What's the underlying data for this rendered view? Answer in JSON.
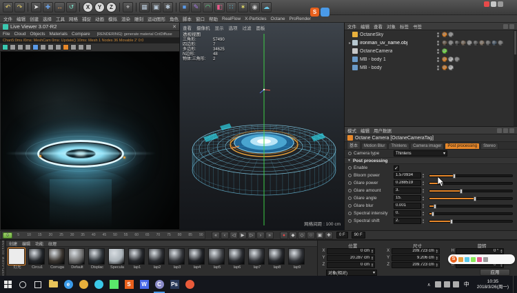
{
  "topbar": {
    "icons": [
      {
        "name": "undo-icon",
        "glyph": "↶",
        "color": "#e8d06a"
      },
      {
        "name": "redo-icon",
        "glyph": "↷",
        "color": "#e8d06a"
      },
      {
        "sep": true
      },
      {
        "name": "live-select-icon",
        "glyph": "➤",
        "color": "#ececec"
      },
      {
        "name": "move-icon",
        "glyph": "✚",
        "color": "#6aa2e8"
      },
      {
        "name": "scale-icon",
        "glyph": "↔",
        "color": "#e8a05a"
      },
      {
        "name": "rotate-icon",
        "glyph": "↺",
        "color": "#7ae0c8"
      },
      {
        "sep": true
      },
      {
        "name": "x-axis-button",
        "glyph": "X",
        "color": "#222",
        "round": true
      },
      {
        "name": "y-axis-button",
        "glyph": "Y",
        "color": "#222",
        "round": true
      },
      {
        "name": "z-axis-button",
        "glyph": "Z",
        "color": "#222",
        "round": true
      },
      {
        "sep": true
      },
      {
        "name": "coord-system-icon",
        "glyph": "⌖",
        "color": "#c8c8c8"
      },
      {
        "sep": true
      },
      {
        "name": "render-view-icon",
        "glyph": "▦",
        "color": "#b8c8d8"
      },
      {
        "name": "render-picture-icon",
        "glyph": "▣",
        "color": "#b8c8d8"
      },
      {
        "name": "render-settings-icon",
        "glyph": "✱",
        "color": "#b8c8d8"
      },
      {
        "sep": true
      },
      {
        "name": "add-cube-icon",
        "glyph": "■",
        "color": "#5a9ae8"
      },
      {
        "name": "add-spline-icon",
        "glyph": "✎",
        "color": "#a87ae8"
      },
      {
        "name": "add-generator-icon",
        "glyph": "◠",
        "color": "#5ae88a"
      },
      {
        "name": "add-deformer-icon",
        "glyph": "◧",
        "color": "#e85a8a"
      },
      {
        "name": "add-field-icon",
        "glyph": "∷",
        "color": "#5ac8e8"
      },
      {
        "name": "add-light-icon",
        "glyph": "✶",
        "color": "#e8e06a"
      },
      {
        "name": "add-camera-icon",
        "glyph": "◉",
        "color": "#c8c8c8"
      },
      {
        "name": "add-sky-icon",
        "glyph": "☁",
        "color": "#6ac8e8"
      }
    ]
  },
  "menubar": {
    "items": [
      "文件",
      "编辑",
      "创建",
      "选择",
      "工具",
      "网格",
      "捕捉",
      "动画",
      "模拟",
      "渲染",
      "雕刻",
      "运动图形",
      "角色",
      "脚本",
      "窗口",
      "帮助"
    ],
    "plugins": [
      "RealFlow",
      "X-Particles",
      "Octane",
      "ProRender"
    ]
  },
  "live_viewer": {
    "title": "Live Viewer 3.07-R2",
    "close": "✕",
    "menus": [
      "File",
      "Cloud",
      "Objects",
      "Materials",
      "Compare"
    ],
    "status": "[RENDERING]: generate material CntDiffuse",
    "stats": "Chan5:0ms /0ms: MeshCam 0ms: Update() 10ms: Mesh 1 Nodes 36 Movable 2' 0:0",
    "toolbar": [
      {
        "name": "power-icon",
        "color": "#3ac8b0"
      },
      {
        "name": "restart-icon",
        "color": "#9a9a9a"
      },
      {
        "name": "pause-icon",
        "color": "#9a9a9a"
      },
      {
        "name": "lock-resolution-icon",
        "color": "#9a9a9a"
      },
      {
        "name": "camera-sync-icon",
        "color": "#5a9ae8"
      },
      {
        "name": "picture-icon",
        "color": "#9a9a9a"
      },
      {
        "name": "render-region-icon",
        "color": "#9a9a9a"
      },
      {
        "name": "focus-pick-icon",
        "color": "#9a9a9a"
      },
      {
        "name": "material-pick-icon",
        "color": "#e8882a"
      },
      {
        "name": "settings-icon",
        "color": "#9a9a9a"
      },
      {
        "name": "clay-mode-icon",
        "color": "#9a9a9a"
      },
      {
        "name": "filter-icon",
        "color": "#9a9a9a"
      }
    ]
  },
  "viewport": {
    "menus": [
      "查看",
      "摄像机",
      "显示",
      "选项",
      "过滤",
      "面板"
    ],
    "hud_title": "透视视图",
    "hud": [
      {
        "label": "三角形",
        "value": "57490"
      },
      {
        "label": "四边形",
        "value": "7"
      },
      {
        "label": "多边形",
        "value": "34625"
      },
      {
        "label": "N边形",
        "value": "48"
      },
      {
        "label": "物体:三角形",
        "value": "2"
      }
    ],
    "grid_label": "网格间距 : 100 cm"
  },
  "object_manager": {
    "menus": [
      "文件",
      "编辑",
      "查看",
      "对象",
      "标签",
      "书签"
    ],
    "items": [
      {
        "name": "OctaneSky",
        "icon": "sky-object-icon",
        "icon_color": "#e8b03c",
        "expand": false,
        "bold": false,
        "tags": [
          "#e8882a",
          "#9a9a9a"
        ]
      },
      {
        "name": "ironman_uv_name.obj",
        "icon": "mesh-object-icon",
        "icon_color": "#b8c8d0",
        "expand": true,
        "bold": true,
        "tags": [
          "#6a5a4a",
          "#8a8a8a",
          "#4a4a4a",
          "#7a6a5a",
          "#9a9a9a",
          "#5a5a5a",
          "#8a7a6a",
          "#6a6a6a",
          "#4a5a6a",
          "#7a7a7a"
        ]
      },
      {
        "name": "OctaneCamera",
        "icon": "camera-object-icon",
        "icon_color": "#c8c8c8",
        "expand": false,
        "bold": false,
        "tags": [
          "#7ae84a"
        ]
      },
      {
        "name": "MB - body 1",
        "icon": "polygon-object-icon",
        "icon_color": "#6a9ac8",
        "expand": false,
        "bold": false,
        "tags": [
          "#e8882a",
          "#c8c8c8",
          "#8a8a8a"
        ]
      },
      {
        "name": "MB - body",
        "icon": "polygon-object-icon",
        "icon_color": "#6a9ac8",
        "expand": false,
        "bold": false,
        "tags": [
          "#e8882a",
          "#c8c8c8"
        ]
      }
    ]
  },
  "attributes": {
    "header_menus": [
      "模式",
      "编辑",
      "用户数据"
    ],
    "title": "Octane Camera [OctaneCameraTag]",
    "tabs": [
      {
        "label": "基本",
        "active": false
      },
      {
        "label": "Motion Blur",
        "active": false
      },
      {
        "label": "Thinlens",
        "active": false
      },
      {
        "label": "Camera imager",
        "active": false
      },
      {
        "label": "Post processing",
        "active": true
      },
      {
        "label": "Stereo",
        "active": false
      }
    ],
    "camera_type_label": "Camera type",
    "camera_type_value": "Thinlens",
    "section": "Post processing",
    "params": [
      {
        "label": "Enable",
        "type": "check",
        "checked": true
      },
      {
        "label": "Bloom power",
        "value": "1.570934",
        "frac": 0.3
      },
      {
        "label": "Glare power",
        "value": "0.288519",
        "frac": 0.15
      },
      {
        "label": "Glare amount",
        "value": "3.",
        "frac": 0.38
      },
      {
        "label": "Glare angle",
        "value": "15.",
        "frac": 0.55
      },
      {
        "label": "Glare blur",
        "value": "0.001",
        "frac": 0.07
      },
      {
        "label": "Spectral intensity",
        "value": "0.",
        "frac": 0.04
      },
      {
        "label": "Spectral shift",
        "value": "2.",
        "frac": 0.27
      }
    ]
  },
  "timeline": {
    "current": "0",
    "ticks": [
      "0",
      "5",
      "10",
      "15",
      "20",
      "25",
      "30",
      "35",
      "40",
      "45",
      "50",
      "55",
      "60",
      "65",
      "70",
      "75",
      "80",
      "85",
      "90"
    ],
    "transport": [
      {
        "name": "goto-start-button",
        "glyph": "«",
        "color": "#cacaca"
      },
      {
        "name": "prev-key-button",
        "glyph": "‹",
        "color": "#cacaca"
      },
      {
        "name": "prev-frame-button",
        "glyph": "◁",
        "color": "#cacaca"
      },
      {
        "name": "play-button",
        "glyph": "▶",
        "color": "#cacaca"
      },
      {
        "name": "next-frame-button",
        "glyph": "▷",
        "color": "#cacaca"
      },
      {
        "name": "next-key-button",
        "glyph": "›",
        "color": "#cacaca"
      },
      {
        "name": "goto-end-button",
        "glyph": "»",
        "color": "#cacaca"
      }
    ],
    "record": [
      {
        "name": "record-button",
        "glyph": "●",
        "color": "#e84a4a"
      },
      {
        "name": "autokey-button",
        "glyph": "◆",
        "color": "#cacaca"
      },
      {
        "name": "key-position-button",
        "glyph": "◇",
        "color": "#cacaca"
      },
      {
        "name": "key-scale-button",
        "glyph": "○",
        "color": "#cacaca"
      },
      {
        "name": "key-rotation-button",
        "glyph": "▣",
        "color": "#cacaca"
      },
      {
        "name": "key-parameter-button",
        "glyph": "✚",
        "color": "#cacaca"
      }
    ],
    "start_field": "0 F",
    "end_field": "90 F"
  },
  "materials": {
    "menus": [
      "创建",
      "编辑",
      "功能",
      "纹理"
    ],
    "side_tabs": [
      "OCTANE",
      "DISPLACEM"
    ],
    "items": [
      {
        "label": "灯光",
        "color": "#ececec",
        "flat": true,
        "selected": true
      },
      {
        "label": "Circu1",
        "color": "#23262a"
      },
      {
        "label": "Corruga",
        "color": "#3a3530"
      },
      {
        "label": "Default",
        "color": "#6e6e6e"
      },
      {
        "label": "Displac",
        "color": "#2e3338"
      },
      {
        "label": "Specula",
        "color": "#aab2b8"
      },
      {
        "label": "lap1",
        "color": "#26282c"
      },
      {
        "label": "lap2",
        "color": "#2c2e32"
      },
      {
        "label": "lap3",
        "color": "#34363a"
      },
      {
        "label": "lap4",
        "color": "#222428"
      },
      {
        "label": "lap5",
        "color": "#3c3e42"
      },
      {
        "label": "lap6",
        "color": "#2a2c30"
      },
      {
        "label": "lap7",
        "color": "#303236"
      },
      {
        "label": "lap8",
        "color": "#26282c"
      },
      {
        "label": "lap9",
        "color": "#2e3034"
      }
    ]
  },
  "coords": {
    "groups": [
      {
        "title": "位置",
        "rows": [
          {
            "axis": "X",
            "value": "0 cm"
          },
          {
            "axis": "Y",
            "value": "20.287 cm"
          },
          {
            "axis": "Z",
            "value": "0 cm"
          }
        ]
      },
      {
        "title": "尺寸",
        "rows": [
          {
            "axis": "X",
            "value": "209.723 cm"
          },
          {
            "axis": "Y",
            "value": "9.206 cm"
          },
          {
            "axis": "Z",
            "value": "209.723 cm"
          }
        ]
      },
      {
        "title": "旋转",
        "rows": [
          {
            "axis": "H",
            "value": "0 °"
          },
          {
            "axis": "P",
            "value": "0 °"
          },
          {
            "axis": "B",
            "value": "0 °"
          }
        ]
      }
    ],
    "mode": "对象(相对)",
    "apply_label": "应用"
  },
  "taskbar": {
    "icons": [
      {
        "name": "search-icon",
        "shape": "circ"
      },
      {
        "name": "task-view-icon",
        "shape": "sq"
      },
      {
        "name": "file-explorer-icon",
        "shape": "folder"
      },
      {
        "name": "edge-icon",
        "shape": "circle",
        "color": "#3a9ae8",
        "glyph": "e"
      },
      {
        "name": "chrome-icon",
        "shape": "circle",
        "color": "#e8b03c",
        "glyph": ""
      },
      {
        "name": "qq-icon",
        "shape": "circle",
        "color": "#3ac8e8",
        "glyph": ""
      },
      {
        "name": "wechat-icon",
        "shape": "square",
        "color": "#5ae86a",
        "glyph": ""
      },
      {
        "name": "sogou-icon",
        "shape": "square",
        "color": "#e8601c",
        "glyph": "S"
      },
      {
        "name": "word-icon",
        "shape": "square",
        "color": "#4a6ae8",
        "glyph": "W"
      },
      {
        "name": "cinema4d-icon",
        "shape": "circle",
        "color": "#8a8ac8",
        "glyph": "C",
        "active": true
      },
      {
        "name": "photoshop-icon",
        "shape": "square",
        "color": "#2a3a5a",
        "glyph": "Ps"
      },
      {
        "name": "video-player-icon",
        "shape": "circle",
        "color": "#e85a3a",
        "glyph": ""
      }
    ],
    "tray": {
      "caret": "∧",
      "chips": [
        "network-icon",
        "volume-icon",
        "antivirus-icon"
      ],
      "input": "中",
      "time": "10:35",
      "date": "2018/3/26(周一)"
    }
  },
  "overlays": {
    "top_float": [
      {
        "name": "sogou-tray-icon",
        "glyph": "S",
        "color": "#e8601c"
      },
      {
        "name": "pc-manager-icon",
        "glyph": "",
        "color": "#4a9ae8"
      }
    ],
    "recorder": [
      {
        "name": "record-dot-icon",
        "color": "#e84a4a"
      },
      {
        "name": "recorder-pause-icon",
        "color": "#c8c8c8"
      },
      {
        "name": "recorder-stop-icon",
        "color": "#9a9a9a"
      }
    ],
    "sogou_bar": {
      "logo": "S",
      "chips": [
        "#e8a03c",
        "#5ac8e8",
        "#8ae85a",
        "#e85a8a",
        "#9a9a9a"
      ]
    }
  }
}
